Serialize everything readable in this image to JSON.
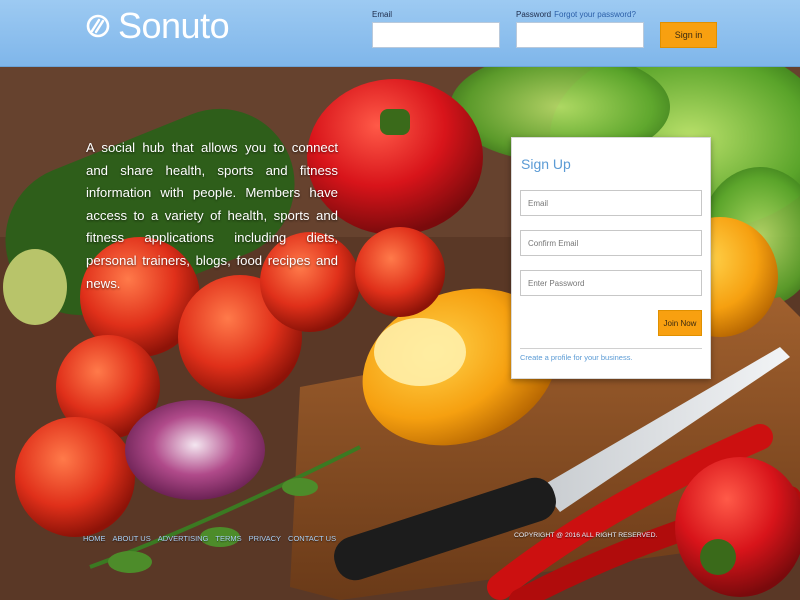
{
  "header": {
    "logo_text": "Sonuto",
    "email_label": "Email",
    "password_label": "Password",
    "forgot_link": "Forgot your password?",
    "email_value": "",
    "password_value": "",
    "signin_label": "Sign in"
  },
  "hero": {
    "tagline": "A social hub that allows you to connect and share health, sports and fitness information with people. Members have access to a variety of health, sports and fitness applications including diets, personal trainers, blogs, food recipes and news."
  },
  "signup": {
    "title": "Sign Up",
    "email_placeholder": "Email",
    "confirm_email_placeholder": "Confirm Email",
    "password_placeholder": "Enter Password",
    "join_label": "Join Now",
    "business_link": "Create a profile for your business."
  },
  "footer": {
    "links": [
      "HOME",
      "ABOUT US",
      "ADVERTISING",
      "TERMS",
      "PRIVACY",
      "CONTACT US"
    ],
    "copyright": "COPYRIGHT @ 2016 ALL RIGHT RESERVED."
  },
  "colors": {
    "header_blue": "#8fc0ef",
    "accent_orange": "#f8a010",
    "link_blue": "#5b9bd5"
  }
}
